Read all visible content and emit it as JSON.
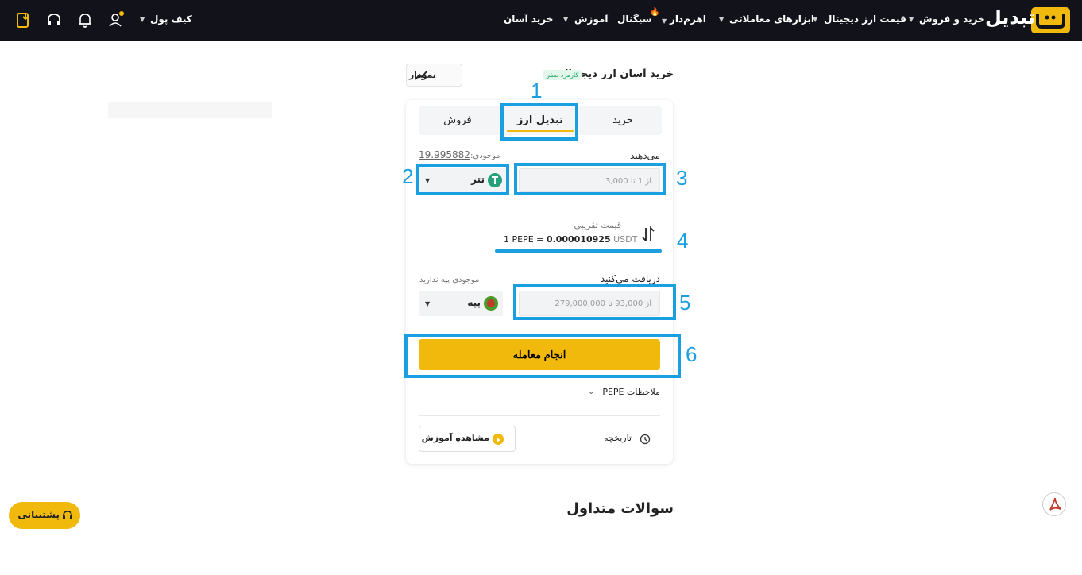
{
  "nav": {
    "logo": "تبدیل",
    "items": [
      {
        "label": "خرید و فروش"
      },
      {
        "label": "قیمت ارز دیجیتال"
      },
      {
        "label": "ابزارهای معاملاتی"
      },
      {
        "label": "اهرم‌دار"
      },
      {
        "label": "سیگنال"
      },
      {
        "label": "آموزش"
      },
      {
        "label": "خرید آسان"
      }
    ],
    "wallet": "کیف پول"
  },
  "page": {
    "title": "خرید آسان ارز دیجیتال",
    "badge": "کارمزد صفر",
    "chart_button": "نمودار"
  },
  "tabs": {
    "buy": "خرید",
    "convert": "تبدیل ارز",
    "sell": "فروش"
  },
  "give": {
    "label": "می‌دهید",
    "balance_label": "موجودی:",
    "balance_value": "19.995882",
    "placeholder": "از 1 تا 3,000",
    "currency": "تتر"
  },
  "rate": {
    "label": "قیمت تقریبی",
    "base": "1 PEPE =",
    "value": "0.000010925",
    "quote": "USDT"
  },
  "receive": {
    "label": "دریافت می‌کنید",
    "balance_note": "موجودی پپه ندارید",
    "placeholder": "از 93,000 تا 279,000,000",
    "currency": "پپه"
  },
  "actions": {
    "trade": "انجام معامله",
    "notes": "ملاحظات PEPE",
    "history": "تاریخچه",
    "tutorial": "مشاهده آموزش"
  },
  "faq": {
    "title": "سوالات متداول"
  },
  "support": {
    "label": "پشتیبانی"
  },
  "annotations": [
    "1",
    "2",
    "3",
    "4",
    "5",
    "6"
  ],
  "colors": {
    "topbar": "#12131a",
    "brand": "#f0b90b",
    "annotation": "#1a9fe0",
    "badge_text": "#1ea86a"
  }
}
